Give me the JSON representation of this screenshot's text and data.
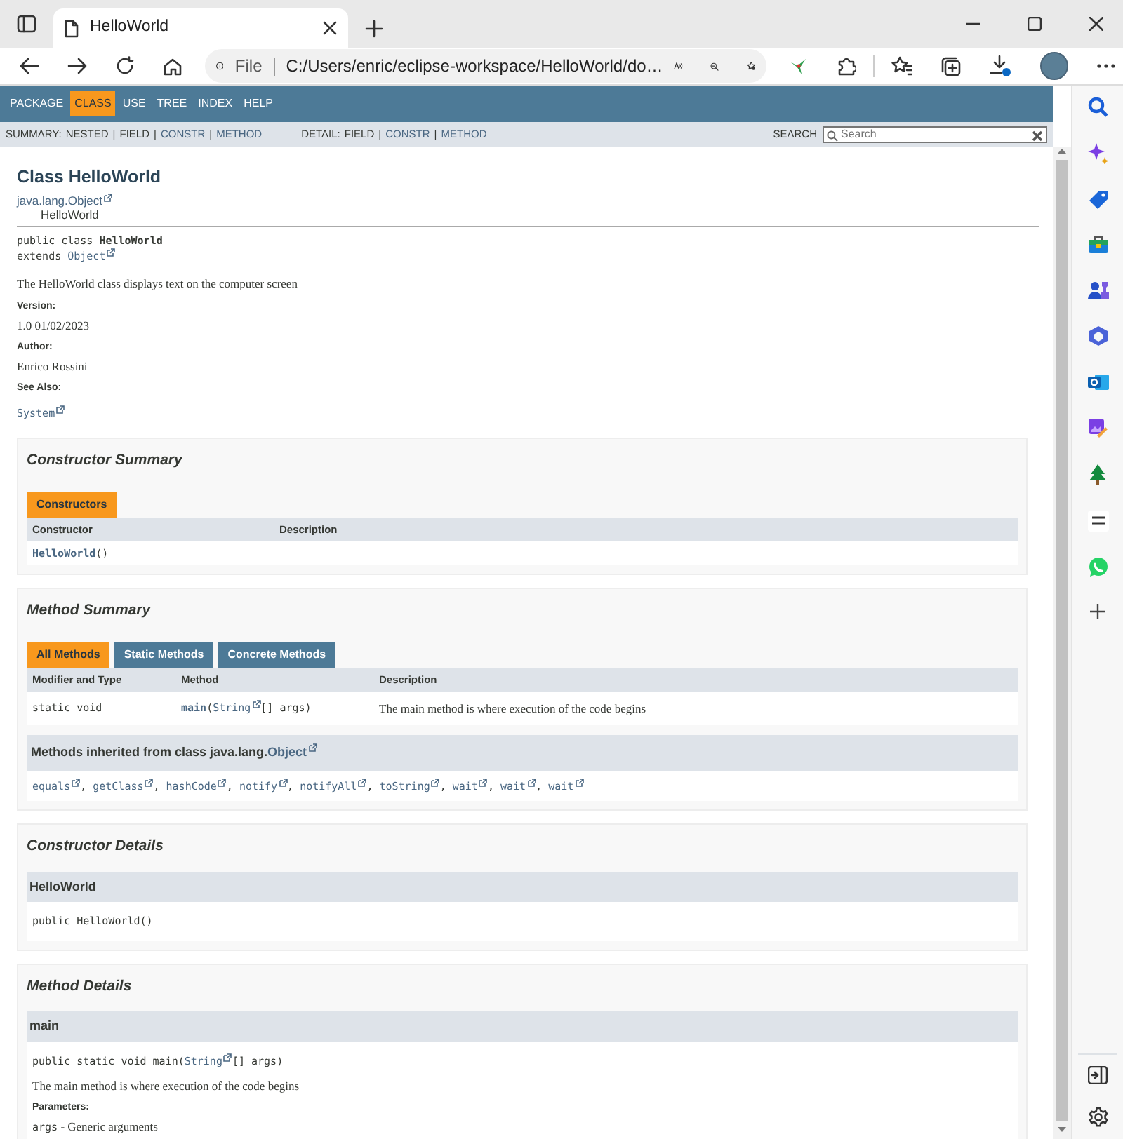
{
  "browser": {
    "tab_title": "HelloWorld",
    "address_scheme": "File",
    "address": "C:/Users/enric/eclipse-workspace/HelloWorld/do…"
  },
  "top_nav": [
    {
      "label": "PACKAGE",
      "selected": false
    },
    {
      "label": "CLASS",
      "selected": true
    },
    {
      "label": "USE",
      "selected": false
    },
    {
      "label": "TREE",
      "selected": false
    },
    {
      "label": "INDEX",
      "selected": false
    },
    {
      "label": "HELP",
      "selected": false
    }
  ],
  "sub_nav": {
    "summary_label": "SUMMARY:",
    "summary": [
      {
        "label": "NESTED",
        "kind": "plain"
      },
      {
        "label": "FIELD",
        "kind": "plain"
      },
      {
        "label": "CONSTR",
        "kind": "link"
      },
      {
        "label": "METHOD",
        "kind": "link"
      }
    ],
    "detail_label": "DETAIL:",
    "detail": [
      {
        "label": "FIELD",
        "kind": "plain"
      },
      {
        "label": "CONSTR",
        "kind": "link"
      },
      {
        "label": "METHOD",
        "kind": "link"
      }
    ],
    "separator": "|",
    "search_label": "SEARCH",
    "search_placeholder": "Search"
  },
  "class_header": {
    "title": "Class HelloWorld",
    "inheritance": {
      "text": "java.lang.Object",
      "kind": "ext-link",
      "children": [
        {
          "text": "HelloWorld",
          "kind": "plain"
        }
      ]
    },
    "signature": [
      [
        {
          "text": "public class ",
          "kind": "plain"
        },
        {
          "text": "HelloWorld",
          "kind": "bold"
        }
      ],
      [
        {
          "text": "extends ",
          "kind": "plain"
        },
        {
          "text": "Object",
          "kind": "ext-link"
        }
      ]
    ],
    "description": "The HelloWorld class displays text on the computer screen",
    "tags": [
      {
        "label": "Version:",
        "value": [
          {
            "text": "1.0 01/02/2023",
            "kind": "serif"
          }
        ]
      },
      {
        "label": "Author:",
        "value": [
          {
            "text": "Enrico Rossini",
            "kind": "serif"
          }
        ]
      },
      {
        "label": "See Also:",
        "value": [
          {
            "text": "System",
            "kind": "ext-link"
          }
        ]
      }
    ]
  },
  "constructor_summary": {
    "title": "Constructor Summary",
    "tabs": [
      {
        "label": "Constructors",
        "selected": true
      }
    ],
    "columns": [
      "Constructor",
      "Description"
    ],
    "rows": [
      {
        "constructor": [
          {
            "text": "HelloWorld",
            "kind": "link"
          },
          {
            "text": "()",
            "kind": "plain"
          }
        ]
      }
    ]
  },
  "method_summary": {
    "title": "Method Summary",
    "tabs": [
      {
        "label": "All Methods",
        "selected": true
      },
      {
        "label": "Static Methods",
        "selected": false
      },
      {
        "label": "Concrete Methods",
        "selected": false
      }
    ],
    "columns": [
      "Modifier and Type",
      "Method",
      "Description"
    ],
    "rows": [
      {
        "modifier": "static void",
        "method": [
          {
            "text": "main",
            "kind": "link"
          },
          {
            "text": "(",
            "kind": "plain"
          },
          {
            "text": "String",
            "kind": "ext-link"
          },
          {
            "text": "[] args)",
            "kind": "plain"
          }
        ],
        "description": "The main method is where execution of the code begins"
      }
    ],
    "inherited": {
      "heading": [
        {
          "text": "Methods inherited from class java.lang.",
          "kind": "plain"
        },
        {
          "text": "Object",
          "kind": "ext-link"
        }
      ],
      "separator": ", ",
      "methods": [
        "equals",
        "getClass",
        "hashCode",
        "notify",
        "notifyAll",
        "toString",
        "wait",
        "wait",
        "wait"
      ]
    }
  },
  "constructor_details": {
    "title": "Constructor Details",
    "items": [
      {
        "name": "HelloWorld",
        "signature": [
          {
            "text": "public HelloWorld()",
            "kind": "plain"
          }
        ]
      }
    ]
  },
  "method_details": {
    "title": "Method Details",
    "items": [
      {
        "name": "main",
        "signature": [
          {
            "text": "public static void main(",
            "kind": "plain"
          },
          {
            "text": "String",
            "kind": "ext-link"
          },
          {
            "text": "[] args)",
            "kind": "plain"
          }
        ],
        "description": "The main method is where execution of the code begins",
        "params_label": "Parameters:",
        "params": [
          {
            "name": "args",
            "text": " - Generic arguments"
          }
        ]
      }
    ]
  }
}
